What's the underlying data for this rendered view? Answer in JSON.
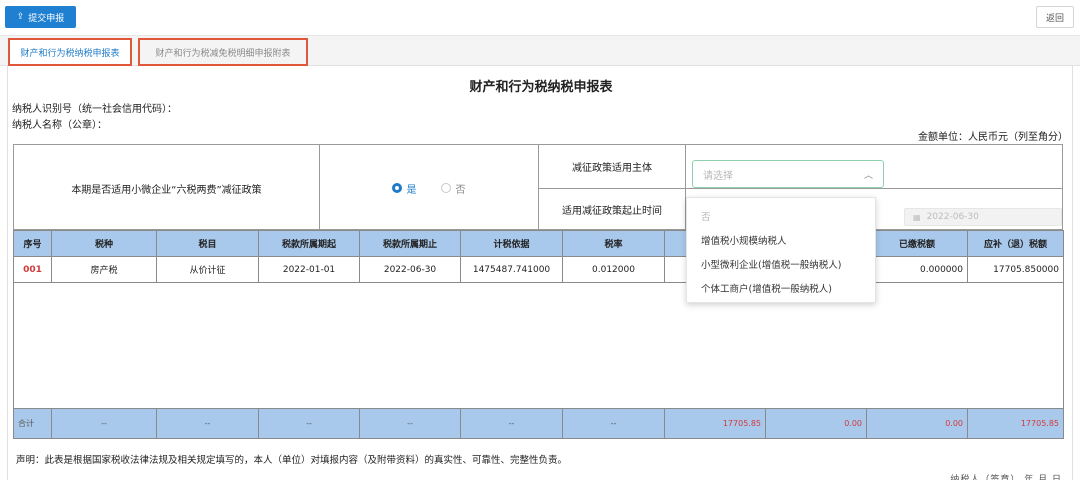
{
  "toolbar": {
    "submit_label": "提交申报",
    "submit_icon": "upload-icon",
    "back_label": "返回"
  },
  "tabs": [
    {
      "label": "财产和行为税纳税申报表",
      "active": true
    },
    {
      "label": "财产和行为税减免税明细申报附表",
      "active": false
    }
  ],
  "form": {
    "title": "财产和行为税纳税申报表",
    "taxpayer_id_label": "纳税人识别号（统一社会信用代码）：",
    "taxpayer_name_label": "纳税人名称（公章）：",
    "unit_label": "金额单位：人民币元（列至角分）"
  },
  "policy": {
    "question": "本期是否适用小微企业“六税两费”减征政策",
    "yes_label": "是",
    "no_label": "否",
    "selected": "是",
    "subject_label": "减征政策适用主体",
    "select_placeholder": "请选择",
    "start_time_label": "适用减征政策起止时间",
    "end_date": "2022-06-30"
  },
  "dropdown": {
    "options": [
      "否",
      "增值税小规模纳税人",
      "小型微利企业(增值税一般纳税人)",
      "个体工商户(增值税一般纳税人)"
    ]
  },
  "table": {
    "headers": [
      "序号",
      "税种",
      "税目",
      "税款所属期起",
      "税款所属期止",
      "计税依据",
      "税率",
      "",
      "",
      "已缴税额",
      "应补（退）税额"
    ],
    "row": {
      "seq": "001",
      "tax_type": "房产税",
      "item": "从价计征",
      "period_start": "2022-01-01",
      "period_end": "2022-06-30",
      "basis": "1475487.741000",
      "rate": "0.012000",
      "paid": "0.000000",
      "payable": "17705.850000"
    },
    "total": {
      "label": "合计",
      "dash": "--",
      "c7": "17705.85",
      "c8": "0.00",
      "c9": "0.00",
      "c10": "17705.85"
    }
  },
  "statement": "声明：此表是根据国家税收法律法规及相关规定填写的，本人（单位）对填报内容（及附带资料）的真实性、可靠性、完整性负责。",
  "footer_partial": "纳税人（签章）      年    月    日",
  "colors": {
    "primary": "#1f7fd1",
    "header_bg": "#a9c9ec",
    "highlight_border": "#e0573b",
    "red_text": "#d23a3a"
  }
}
